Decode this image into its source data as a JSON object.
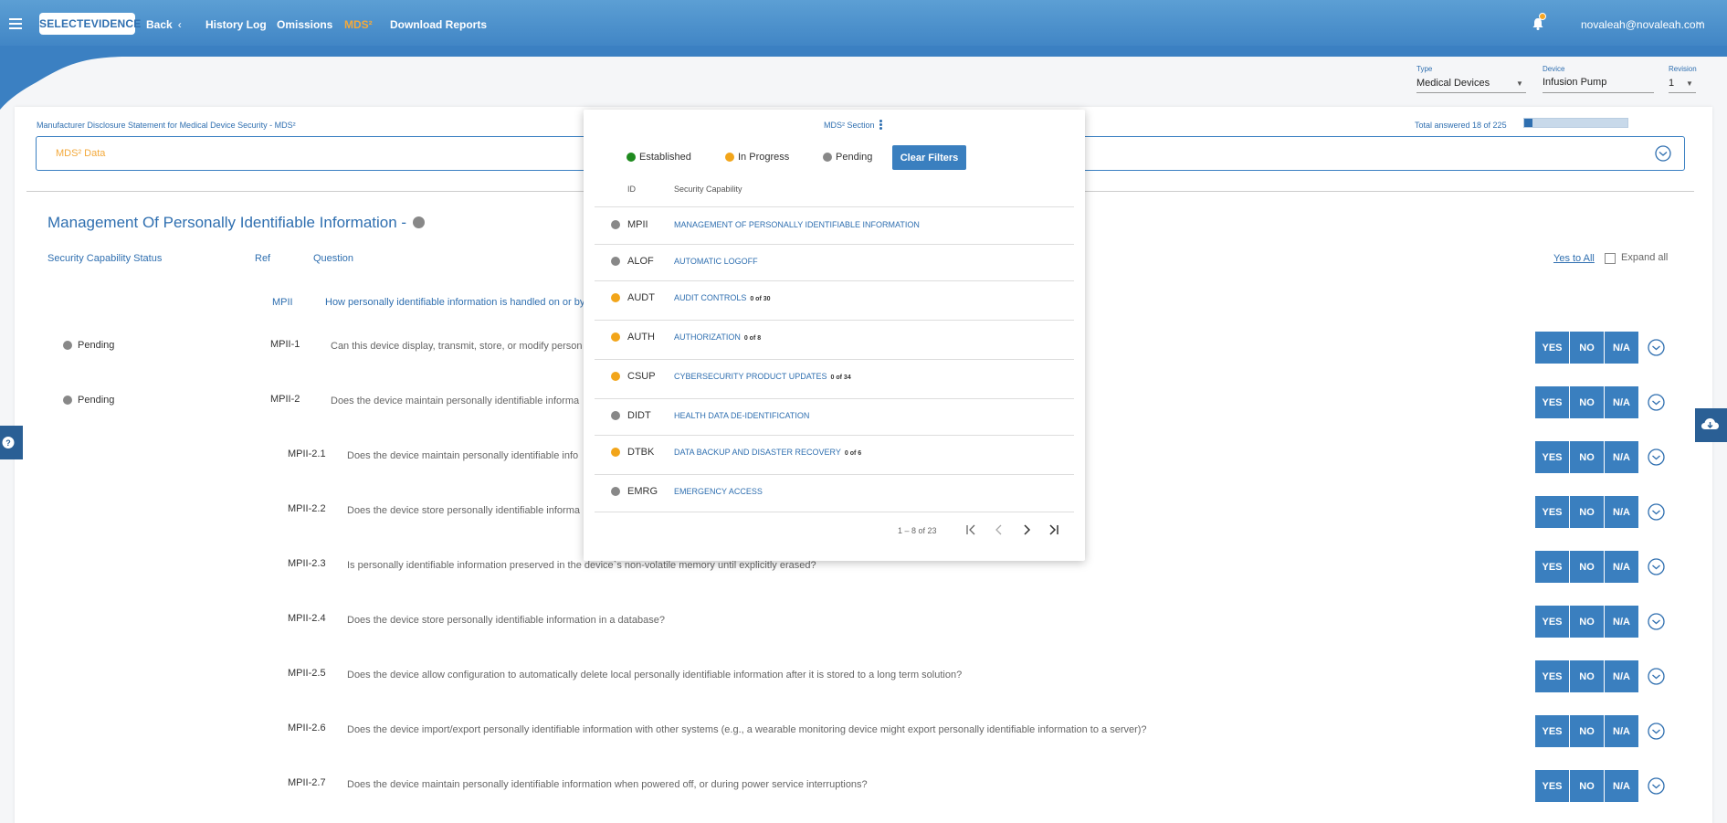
{
  "header": {
    "logo": "SELECTEVIDENCE",
    "back": "Back",
    "nav": [
      "History Log",
      "Omissions",
      "MDS²",
      "Download Reports"
    ],
    "active_nav": "MDS²",
    "user": "novaleah@novaleah.com"
  },
  "selectors": {
    "type_label": "Type",
    "type_value": "Medical Devices",
    "device_label": "Device",
    "device_value": "Infusion Pump",
    "revision_label": "Revision",
    "revision_value": "1"
  },
  "mds": {
    "title": "Manufacturer Disclosure Statement for Medical Device Security - MDS²",
    "total": "Total answered 18 of 225",
    "progress_fraction": 0.08,
    "data_label": "MDS² Data"
  },
  "section": {
    "title": "Management Of Personally Identifiable Information -",
    "col_status": "Security Capability Status",
    "col_ref": "Ref",
    "col_question": "Question",
    "yes_to_all": "Yes to All",
    "expand_all": "Expand all",
    "group_ref": "MPII",
    "group_question": "How personally identifiable information is handled on or by t"
  },
  "buttons": {
    "yes": "YES",
    "no": "NO",
    "na": "N/A"
  },
  "rows": [
    {
      "status": "Pending",
      "ref": "MPII-1",
      "question": "Can this device display, transmit, store, or modify person"
    },
    {
      "status": "Pending",
      "ref": "MPII-2",
      "question": "Does the device maintain personally identifiable informa"
    },
    {
      "status": "",
      "ref": "MPII-2.1",
      "question": "Does the device maintain personally identifiable info"
    },
    {
      "status": "",
      "ref": "MPII-2.2",
      "question": "Does the device store personally identifiable informa"
    },
    {
      "status": "",
      "ref": "MPII-2.3",
      "question": "Is personally identifiable information preserved in the device`s non-volatile memory until explicitly erased?"
    },
    {
      "status": "",
      "ref": "MPII-2.4",
      "question": "Does the device store personally identifiable information in a database?"
    },
    {
      "status": "",
      "ref": "MPII-2.5",
      "question": "Does the device allow configuration to automatically delete local personally identifiable information after it is stored to a long term solution?"
    },
    {
      "status": "",
      "ref": "MPII-2.6",
      "question": "Does the device import/export personally identifiable information with other systems (e.g., a wearable monitoring device might export personally identifiable information to a server)?"
    },
    {
      "status": "",
      "ref": "MPII-2.7",
      "question": "Does the device maintain personally identifiable information when powered off, or during power service interruptions?"
    }
  ],
  "popup": {
    "title": "MDS² Section",
    "legend": [
      {
        "label": "Established",
        "color": "#1e8a1e"
      },
      {
        "label": "In Progress",
        "color": "#f2a51a"
      },
      {
        "label": "Pending",
        "color": "#888888"
      }
    ],
    "clear_filters": "Clear Filters",
    "col_id": "ID",
    "col_capability": "Security Capability",
    "items": [
      {
        "id": "MPII",
        "capability": "MANAGEMENT OF PERSONALLY IDENTIFIABLE INFORMATION",
        "count": "",
        "color": "#888888"
      },
      {
        "id": "ALOF",
        "capability": "AUTOMATIC LOGOFF",
        "count": "",
        "color": "#888888"
      },
      {
        "id": "AUDT",
        "capability": "AUDIT CONTROLS",
        "count": "0 of 30",
        "color": "#f2a51a"
      },
      {
        "id": "AUTH",
        "capability": "AUTHORIZATION",
        "count": "0 of 8",
        "color": "#f2a51a"
      },
      {
        "id": "CSUP",
        "capability": "CYBERSECURITY PRODUCT UPDATES",
        "count": "0 of 34",
        "color": "#f2a51a"
      },
      {
        "id": "DIDT",
        "capability": "HEALTH DATA DE-IDENTIFICATION",
        "count": "",
        "color": "#888888"
      },
      {
        "id": "DTBK",
        "capability": "DATA BACKUP AND DISASTER RECOVERY",
        "count": "0 of 6",
        "color": "#f2a51a"
      },
      {
        "id": "EMRG",
        "capability": "EMERGENCY ACCESS",
        "count": "",
        "color": "#888888"
      }
    ],
    "pager": "1 – 8 of 23"
  }
}
